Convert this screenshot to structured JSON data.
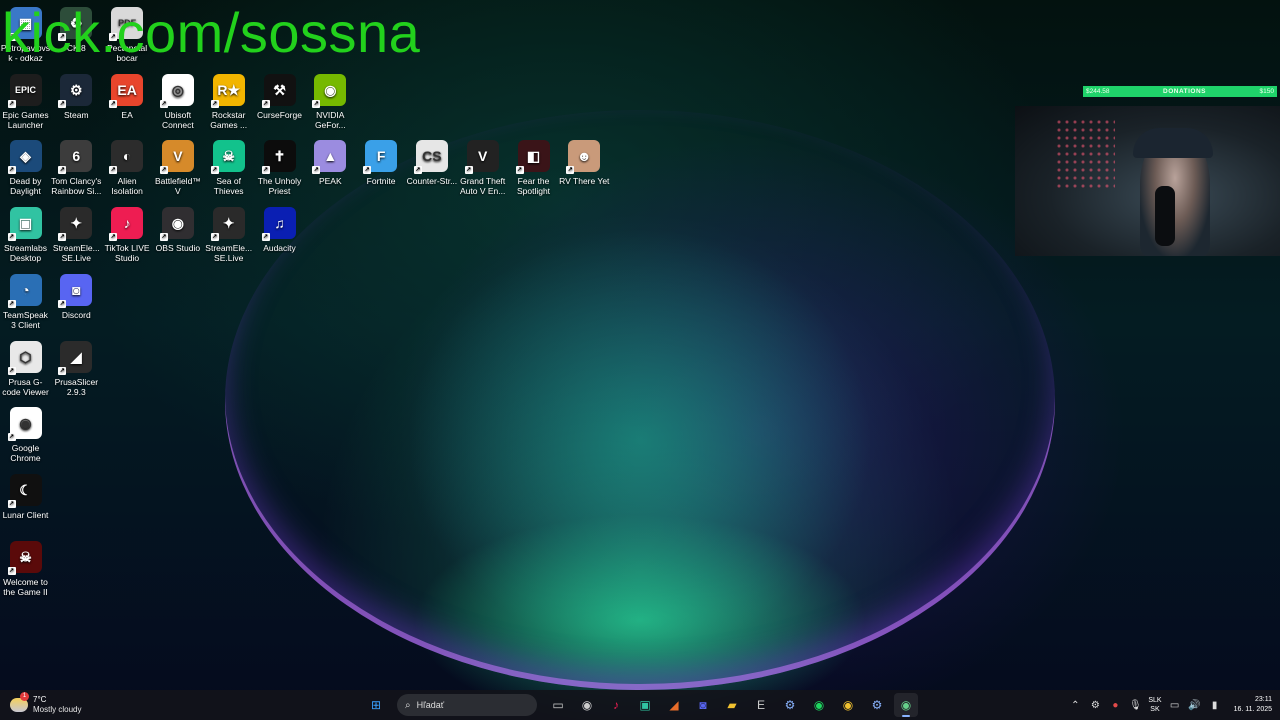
{
  "watermark": "kick.com/sossna",
  "desktop": {
    "icons": [
      {
        "label": "Petropavlovsk - odkaz",
        "name": "icon-odkaz",
        "color": "#3a78c8",
        "glyph": "▦"
      },
      {
        "label": "CK 8",
        "name": "icon-ck8",
        "color": "#2d4d3a",
        "glyph": "♻"
      },
      {
        "label": "Pectopetal bocar",
        "name": "icon-pdf",
        "color": "#d9d9d9",
        "glyph": "PDF"
      },
      {
        "label": "Epic Games Launcher",
        "name": "icon-epic-games",
        "color": "#1d1d1d",
        "glyph": "EPIC"
      },
      {
        "label": "Steam",
        "name": "icon-steam",
        "color": "#1b2838",
        "glyph": "⚙"
      },
      {
        "label": "EA",
        "name": "icon-ea",
        "color": "#e8452c",
        "glyph": "EA"
      },
      {
        "label": "Ubisoft Connect",
        "name": "icon-ubisoft",
        "color": "#ffffff",
        "glyph": "◎"
      },
      {
        "label": "Rockstar Games ...",
        "name": "icon-rockstar",
        "color": "#f2b500",
        "glyph": "R★"
      },
      {
        "label": "CurseForge",
        "name": "icon-curseforge",
        "color": "#111111",
        "glyph": "⚒"
      },
      {
        "label": "NVIDIA GeFor...",
        "name": "icon-nvidia",
        "color": "#76b900",
        "glyph": "◉"
      },
      {
        "label": "Dead by Daylight",
        "name": "icon-dbd",
        "color": "#1b4a7a",
        "glyph": "◈"
      },
      {
        "label": "Tom Clancy's Rainbow Si...",
        "name": "icon-rainbow-six",
        "color": "#3c3c3c",
        "glyph": "6"
      },
      {
        "label": "Alien Isolation",
        "name": "icon-alien",
        "color": "#2c2c2c",
        "glyph": "◐"
      },
      {
        "label": "Battlefield™ V",
        "name": "icon-battlefield",
        "color": "#d68a2a",
        "glyph": "V"
      },
      {
        "label": "Sea of Thieves",
        "name": "icon-sea-of-thieves",
        "color": "#12c28c",
        "glyph": "☠"
      },
      {
        "label": "The Unholy Priest",
        "name": "icon-unholy-priest",
        "color": "#0c0c0c",
        "glyph": "✝"
      },
      {
        "label": "PEAK",
        "name": "icon-peak",
        "color": "#9b8ce0",
        "glyph": "▲"
      },
      {
        "label": "Fortnite",
        "name": "icon-fortnite",
        "color": "#3aa0e8",
        "glyph": "F"
      },
      {
        "label": "Counter-Str...",
        "name": "icon-counter-strike",
        "color": "#e6e6e6",
        "glyph": "CS"
      },
      {
        "label": "Grand Theft Auto V En...",
        "name": "icon-gta5",
        "color": "#222",
        "glyph": "V"
      },
      {
        "label": "Fear the Spotlight",
        "name": "icon-fear-spotlight",
        "color": "#3a1418",
        "glyph": "◧"
      },
      {
        "label": "RV There Yet",
        "name": "icon-rv-there-yet",
        "color": "#c99a7a",
        "glyph": "☻"
      },
      {
        "label": "Streamlabs Desktop",
        "name": "icon-streamlabs",
        "color": "#31c3a2",
        "glyph": "▣"
      },
      {
        "label": "StreamEle... SE.Live",
        "name": "icon-streamelements-1",
        "color": "#2a2a2a",
        "glyph": "✦"
      },
      {
        "label": "TikTok LIVE Studio",
        "name": "icon-tiktok-live",
        "color": "#ee1d52",
        "glyph": "♪"
      },
      {
        "label": "OBS Studio",
        "name": "icon-obs",
        "color": "#302e31",
        "glyph": "◉"
      },
      {
        "label": "StreamEle... SE.Live",
        "name": "icon-streamelements-2",
        "color": "#2a2a2a",
        "glyph": "✦"
      },
      {
        "label": "Audacity",
        "name": "icon-audacity",
        "color": "#0a1fb3",
        "glyph": "♫"
      },
      {
        "label": "TeamSpeak 3 Client",
        "name": "icon-teamspeak",
        "color": "#2a6fb5",
        "glyph": "◔"
      },
      {
        "label": "Discord",
        "name": "icon-discord",
        "color": "#5865f2",
        "glyph": "◙"
      },
      {
        "label": "Prusa G-code Viewer",
        "name": "icon-prusa-gcode",
        "color": "#e8e8e8",
        "glyph": "⬡"
      },
      {
        "label": "PrusaSlicer 2.9.3",
        "name": "icon-prusaslicer",
        "color": "#2b2b2b",
        "glyph": "◢"
      },
      {
        "label": "Google Chrome",
        "name": "icon-chrome",
        "color": "#ffffff",
        "glyph": "◉"
      },
      {
        "label": "Lunar Client",
        "name": "icon-lunar",
        "color": "#101010",
        "glyph": "☾"
      },
      {
        "label": "Welcome to the Game II",
        "name": "icon-welcome-game",
        "color": "#5a0a0a",
        "glyph": "☠"
      }
    ]
  },
  "overlay": {
    "donations_left": "$244.58",
    "donations_title": "DONATIONS",
    "donations_right": "$150"
  },
  "taskbar": {
    "weather_temp": "7°C",
    "weather_cond": "Mostly cloudy",
    "weather_badge": "1",
    "search_placeholder": "Hľadať",
    "lang_top": "SLK",
    "lang_bottom": "SK",
    "time": "23:11",
    "date": "16. 11. 2025",
    "apps": [
      {
        "name": "taskbar-start-button",
        "glyph": "⊞",
        "color": "#3aa0ff"
      },
      {
        "name": "taskbar-task-view",
        "glyph": "▭",
        "color": "#cccccc"
      },
      {
        "name": "taskbar-obs",
        "glyph": "◉",
        "color": "#cccccc"
      },
      {
        "name": "taskbar-tiktok",
        "glyph": "♪",
        "color": "#ee1d52"
      },
      {
        "name": "taskbar-streamlabs",
        "glyph": "▣",
        "color": "#31c3a2"
      },
      {
        "name": "taskbar-prusaslicer",
        "glyph": "◢",
        "color": "#e86d2a"
      },
      {
        "name": "taskbar-discord",
        "glyph": "◙",
        "color": "#5865f2"
      },
      {
        "name": "taskbar-file-explorer",
        "glyph": "▰",
        "color": "#f2c230"
      },
      {
        "name": "taskbar-epic",
        "glyph": "E",
        "color": "#cccccc"
      },
      {
        "name": "taskbar-steam",
        "glyph": "⚙",
        "color": "#8ab4ff"
      },
      {
        "name": "taskbar-spotify",
        "glyph": "◉",
        "color": "#1ed760"
      },
      {
        "name": "taskbar-chrome",
        "glyph": "◉",
        "color": "#f2c230"
      },
      {
        "name": "taskbar-steam-2",
        "glyph": "⚙",
        "color": "#8ab4ff"
      },
      {
        "name": "taskbar-chrome-active",
        "glyph": "◉",
        "color": "#66d08a"
      }
    ]
  }
}
